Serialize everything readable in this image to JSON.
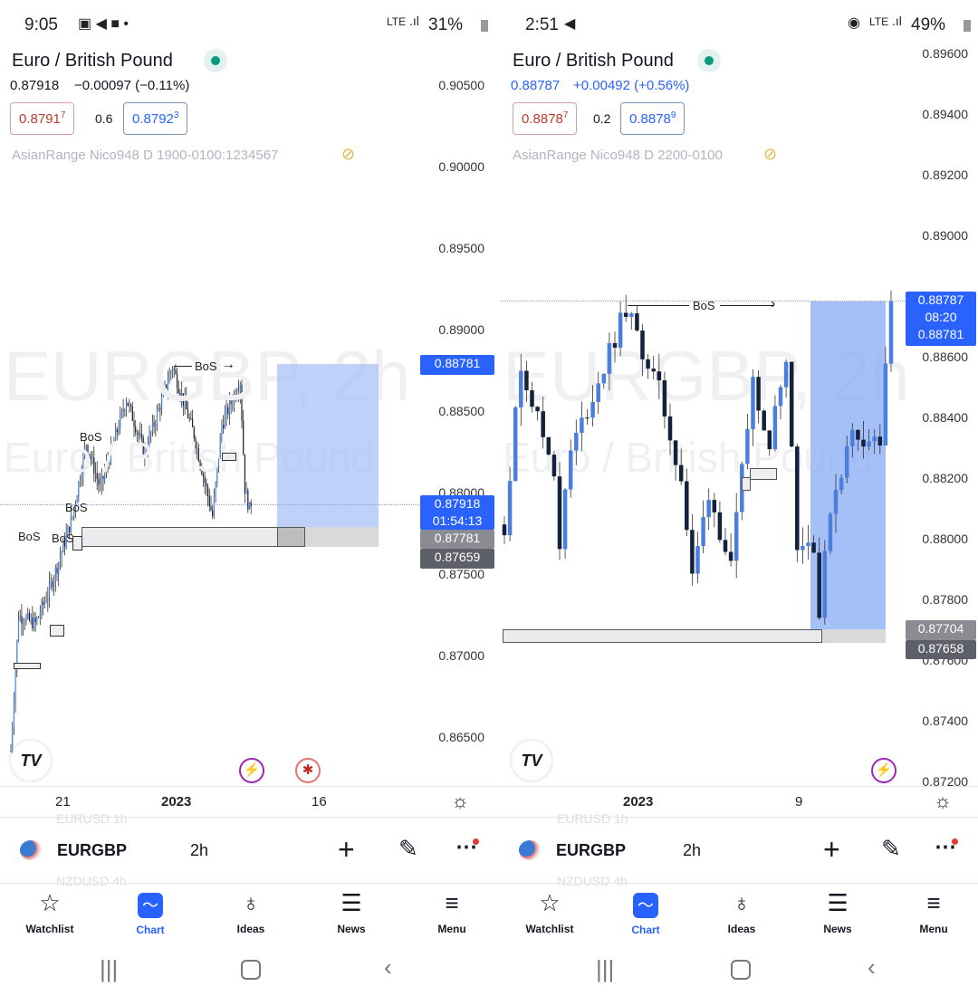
{
  "panels": [
    {
      "status": {
        "time": "9:05",
        "icons": [
          "gallery-icon",
          "telegram-icon",
          "message-icon"
        ],
        "dot": "•",
        "network": "LTE",
        "battery": "31%"
      },
      "symbol_name": "Euro / British Pound",
      "last": "0.87918",
      "change": "−0.00097 (−0.11%)",
      "change_color": "#131722",
      "bid_main": "0.8791",
      "bid_sup": "7",
      "spread": "0.6",
      "ask_main": "0.8792",
      "ask_sup": "3",
      "indicator": "AsianRange Nico948 D 1900-0100:1234567",
      "watermark_1": "EURGBP, 2h",
      "watermark_2": "Euro / British Pound",
      "axis_labels": [
        "0.90500",
        "0.90000",
        "0.89500",
        "0.89000",
        "0.88500",
        "0.88000",
        "0.87500",
        "0.87000",
        "0.86500"
      ],
      "tags": {
        "high": "0.88781",
        "price": "0.87918",
        "countdown": "01:54:13",
        "t1": "0.87781",
        "t2": "0.87659"
      },
      "bos": [
        "BoS",
        "BoS",
        "BoS",
        "BoS",
        "BoS"
      ],
      "time_axis": [
        "21",
        "2023",
        "16"
      ],
      "symbol_bar": {
        "symbol": "EURGBP",
        "timeframe": "2h",
        "prev": "EURUSD  1h",
        "next": "NZDUSD  4h"
      }
    },
    {
      "status": {
        "time": "2:51",
        "icons": [
          "telegram-icon"
        ],
        "network": "LTE",
        "battery": "49%"
      },
      "symbol_name": "Euro / British Pound",
      "last": "0.88787",
      "change": "+0.00492 (+0.56%)",
      "change_color": "#2962ff",
      "bid_main": "0.8878",
      "bid_sup": "7",
      "spread": "0.2",
      "ask_main": "0.8878",
      "ask_sup": "9",
      "indicator": "AsianRange Nico948 D 2200-0100",
      "watermark_1": "EURGBP, 2h",
      "watermark_2": "Euro / British Pound",
      "axis_labels": [
        "0.89600",
        "0.89400",
        "0.89200",
        "0.89000",
        "0.88600",
        "0.88400",
        "0.88200",
        "0.88000",
        "0.87800",
        "0.87600",
        "0.87400",
        "0.87200"
      ],
      "tags": {
        "price": "0.88787",
        "countdown": "08:20",
        "high": "0.88781",
        "t1": "0.87704",
        "t2": "0.87658"
      },
      "bos": [
        "BoS"
      ],
      "time_axis": [
        "2023",
        "9"
      ],
      "symbol_bar": {
        "symbol": "EURGBP",
        "timeframe": "2h",
        "prev": "EURUSD  1h",
        "next": "NZDUSD  4h"
      }
    }
  ],
  "nav": [
    {
      "label": "Watchlist",
      "icon": "star-icon"
    },
    {
      "label": "Chart",
      "icon": "chart-icon",
      "active": true
    },
    {
      "label": "Ideas",
      "icon": "lightbulb-icon"
    },
    {
      "label": "News",
      "icon": "news-icon"
    },
    {
      "label": "Menu",
      "icon": "menu-icon"
    }
  ],
  "colors": {
    "up": "#4a7fe0",
    "down": "#14213d",
    "accent": "#2962ff",
    "target_zone": "#a9c1f5",
    "zone_gray": "#d9d9db"
  },
  "chart_data": [
    {
      "type": "candlestick",
      "symbol": "EURGBP",
      "timeframe": "2h",
      "ylim": [
        0.8625,
        0.9075
      ],
      "last": 0.87918,
      "waypoints": [
        [
          0,
          0.8642
        ],
        [
          5,
          0.8725
        ],
        [
          16,
          0.872
        ],
        [
          25,
          0.8741
        ],
        [
          31,
          0.8758
        ],
        [
          40,
          0.8786
        ],
        [
          49,
          0.8831
        ],
        [
          58,
          0.8803
        ],
        [
          75,
          0.8858
        ],
        [
          87,
          0.8825
        ],
        [
          105,
          0.8878
        ],
        [
          119,
          0.8836
        ],
        [
          131,
          0.8786
        ],
        [
          137,
          0.8842
        ],
        [
          149,
          0.8869
        ],
        [
          152,
          0.8803
        ],
        [
          156,
          0.8786
        ]
      ]
    },
    {
      "type": "candlestick",
      "symbol": "EURGBP",
      "timeframe": "2h",
      "ylim": [
        0.8715,
        0.8965
      ],
      "last": 0.88787,
      "waypoints": [
        [
          0,
          0.8805
        ],
        [
          3,
          0.8858
        ],
        [
          6,
          0.884
        ],
        [
          9,
          0.8823
        ],
        [
          10,
          0.8799
        ],
        [
          12,
          0.8829
        ],
        [
          17,
          0.8852
        ],
        [
          22,
          0.8876
        ],
        [
          28,
          0.8849
        ],
        [
          32,
          0.882
        ],
        [
          34,
          0.8787
        ],
        [
          37,
          0.8816
        ],
        [
          41,
          0.879
        ],
        [
          45,
          0.8853
        ],
        [
          48,
          0.8832
        ],
        [
          51,
          0.8862
        ],
        [
          53,
          0.8799
        ],
        [
          56,
          0.8799
        ],
        [
          57,
          0.8775
        ],
        [
          59,
          0.8811
        ],
        [
          63,
          0.8835
        ],
        [
          68,
          0.8832
        ],
        [
          70,
          0.8879
        ]
      ]
    }
  ]
}
